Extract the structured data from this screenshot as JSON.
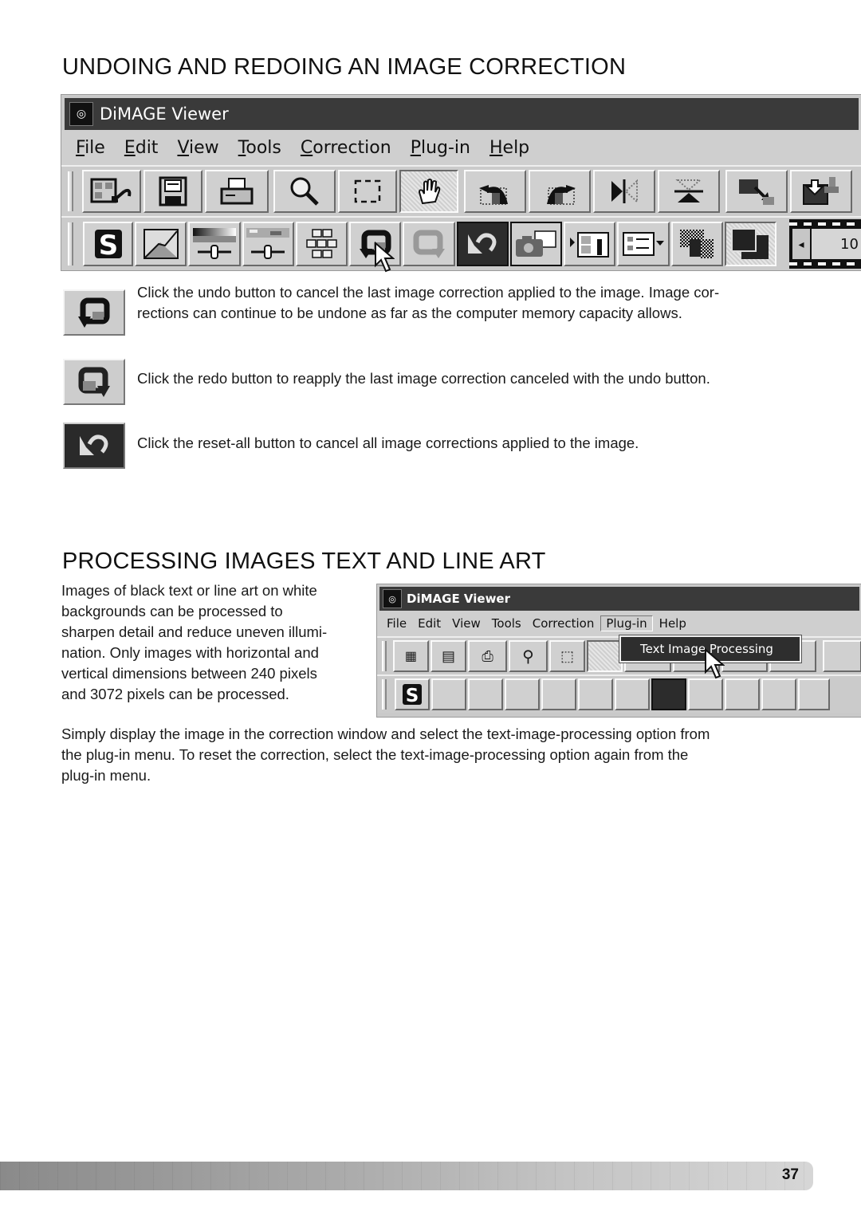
{
  "section1": {
    "title": "UNDOING AND REDOING AN IMAGE CORRECTION",
    "screenshot": {
      "window_title": "DiMAGE Viewer",
      "menu": [
        {
          "label": "File",
          "accel": "F"
        },
        {
          "label": "Edit",
          "accel": "E"
        },
        {
          "label": "View",
          "accel": "V"
        },
        {
          "label": "Tools",
          "accel": "T"
        },
        {
          "label": "Correction",
          "accel": "C"
        },
        {
          "label": "Plug-in",
          "accel": "P"
        },
        {
          "label": "Help",
          "accel": "H"
        }
      ],
      "toolbar1_icons": [
        "thumbnail-return-icon",
        "save-disk-icon",
        "print-icon",
        "magnifier-icon",
        "selection-marquee-icon",
        "hand-icon",
        "rotate-left-icon",
        "rotate-right-icon",
        "flip-horizontal-icon",
        "flip-vertical-icon",
        "resize-icon",
        "import-stamp-icon"
      ],
      "toolbar2_icons": [
        "variation-s-icon",
        "tone-curve-icon",
        "brightness-slider-icon",
        "saturation-slider-icon",
        "color-grid-icon",
        "undo-icon",
        "redo-icon",
        "reset-all-icon",
        "camera-snapshot-icon",
        "slideshow-icon",
        "list-view-icon",
        "pattern-compare-icon",
        "before-after-icon"
      ],
      "frame_counter": "10"
    },
    "items": [
      {
        "icon": "undo-icon",
        "text": "Click the undo button to cancel the last image correction applied to the image. Image cor-rections can continue to be undone as far as the computer memory capacity allows.",
        "line1": "Click the undo button to cancel the last image correction applied to the image. Image cor-",
        "line2": "rections can continue to be undone as far as the computer memory capacity allows."
      },
      {
        "icon": "redo-icon",
        "text": "Click the redo button to reapply the last image correction canceled with the undo button."
      },
      {
        "icon": "reset-all-icon",
        "text": "Click the reset-all button to cancel all image corrections applied to the image."
      }
    ]
  },
  "section2": {
    "title": "PROCESSING IMAGES TEXT AND LINE ART",
    "intro_lines": [
      "Images of black text or line art on white",
      "backgrounds can be processed to",
      "sharpen detail and reduce uneven illumi-",
      "nation. Only images with horizontal and",
      "vertical dimensions between 240 pixels",
      "and 3072 pixels can be processed."
    ],
    "screenshot": {
      "window_title": "DiMAGE Viewer",
      "menu": [
        "File",
        "Edit",
        "View",
        "Tools",
        "Correction",
        "Plug-in",
        "Help"
      ],
      "active_menu": "Plug-in",
      "dropdown_item": "Text Image Processing"
    },
    "body_lines": [
      "Simply display the image in the correction window and select the text-image-processing option from",
      "the plug-in menu. To reset the correction, select the text-image-processing option again from the",
      "plug-in menu."
    ]
  },
  "footer": {
    "page_number": "37"
  }
}
